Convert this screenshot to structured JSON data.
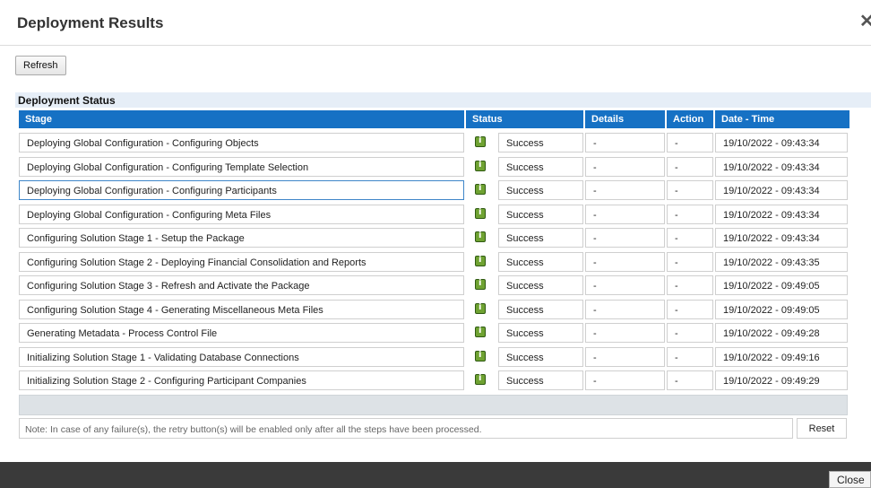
{
  "dialog": {
    "title": "Deployment Results",
    "close_glyph": "✕"
  },
  "toolbar": {
    "refresh_label": "Refresh"
  },
  "section": {
    "title": "Deployment Status"
  },
  "columns": {
    "stage": "Stage",
    "status": "Status",
    "details": "Details",
    "action": "Action",
    "datetime": "Date - Time"
  },
  "rows": [
    {
      "stage": "Deploying Global Configuration - Configuring Objects",
      "status": "Success",
      "details": "-",
      "action": "-",
      "datetime": "19/10/2022 - 09:43:34"
    },
    {
      "stage": "Deploying Global Configuration - Configuring Template Selection",
      "status": "Success",
      "details": "-",
      "action": "-",
      "datetime": "19/10/2022 - 09:43:34"
    },
    {
      "stage": "Deploying Global Configuration - Configuring Participants",
      "status": "Success",
      "details": "-",
      "action": "-",
      "datetime": "19/10/2022 - 09:43:34"
    },
    {
      "stage": "Deploying Global Configuration - Configuring Meta Files",
      "status": "Success",
      "details": "-",
      "action": "-",
      "datetime": "19/10/2022 - 09:43:34"
    },
    {
      "stage": "Configuring Solution Stage 1 - Setup the Package",
      "status": "Success",
      "details": "-",
      "action": "-",
      "datetime": "19/10/2022 - 09:43:34"
    },
    {
      "stage": "Configuring Solution Stage 2 - Deploying Financial Consolidation and Reports",
      "status": "Success",
      "details": "-",
      "action": "-",
      "datetime": "19/10/2022 - 09:43:35"
    },
    {
      "stage": "Configuring Solution Stage 3 - Refresh and Activate the Package",
      "status": "Success",
      "details": "-",
      "action": "-",
      "datetime": "19/10/2022 - 09:49:05"
    },
    {
      "stage": "Configuring Solution Stage 4 - Generating Miscellaneous Meta Files",
      "status": "Success",
      "details": "-",
      "action": "-",
      "datetime": "19/10/2022 - 09:49:05"
    },
    {
      "stage": "Generating Metadata - Process Control File",
      "status": "Success",
      "details": "-",
      "action": "-",
      "datetime": "19/10/2022 - 09:49:28"
    },
    {
      "stage": "Initializing Solution Stage 1 - Validating Database Connections",
      "status": "Success",
      "details": "-",
      "action": "-",
      "datetime": "19/10/2022 - 09:49:16"
    },
    {
      "stage": "Initializing Solution Stage 2 - Configuring Participant Companies",
      "status": "Success",
      "details": "-",
      "action": "-",
      "datetime": "19/10/2022 - 09:49:29"
    }
  ],
  "note": "Note: In case of any failure(s), the retry button(s) will be enabled only after all the steps have been processed.",
  "reset_label": "Reset",
  "close_label": "Close",
  "colors": {
    "header": "#1671c4",
    "status_icon": "#6fa232",
    "footer": "#3a3a3a"
  },
  "icons": {
    "status": "info-icon"
  }
}
